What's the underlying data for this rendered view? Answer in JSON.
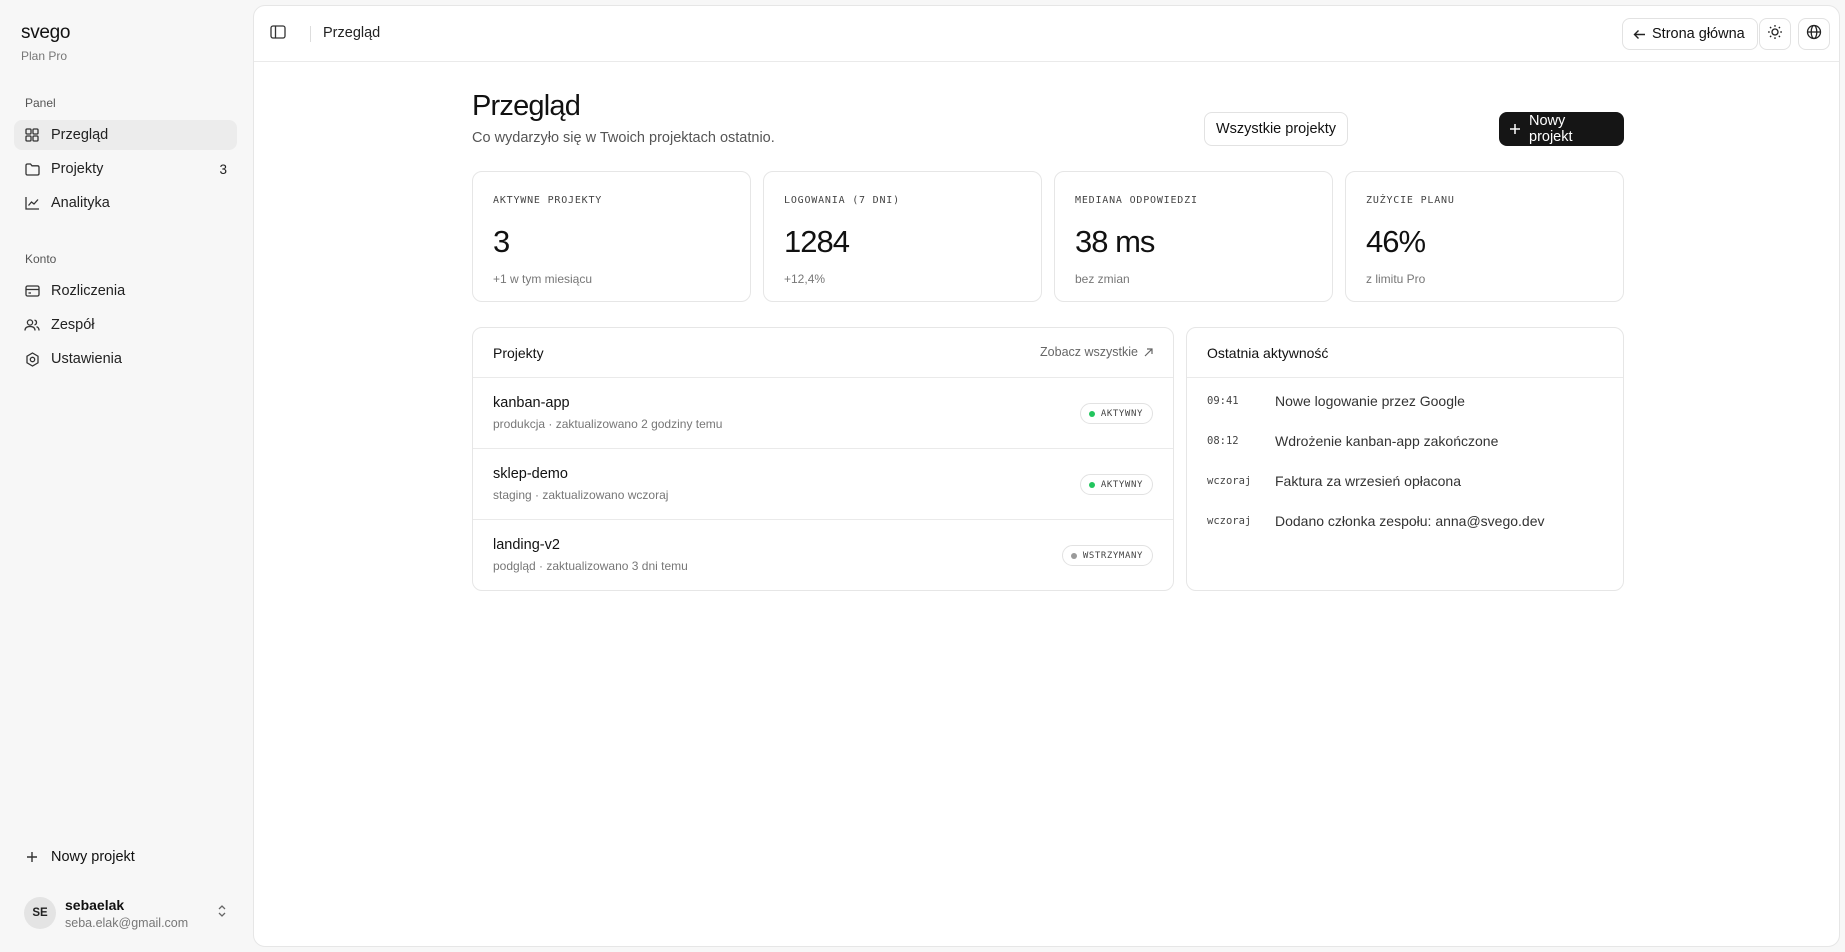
{
  "app": {
    "name": "svego",
    "plan": "Plan Pro"
  },
  "sidebar": {
    "panel_label": "Panel",
    "account_label": "Konto",
    "panel_items": [
      {
        "label": "Przegląd",
        "icon": "grid-icon",
        "active": true
      },
      {
        "label": "Projekty",
        "icon": "folder-icon",
        "count": "3"
      },
      {
        "label": "Analityka",
        "icon": "chart-line-icon"
      }
    ],
    "account_items": [
      {
        "label": "Rozliczenia",
        "icon": "credit-card-icon"
      },
      {
        "label": "Zespół",
        "icon": "users-icon"
      },
      {
        "label": "Ustawienia",
        "icon": "settings-icon"
      }
    ],
    "new_project_label": "Nowy projekt",
    "user": {
      "initials": "SE",
      "name": "sebaelak",
      "email": "seba.elak@gmail.com"
    }
  },
  "topbar": {
    "title": "Przegląd",
    "home_label": "Strona główna",
    "theme_icon": "sun-icon",
    "language_icon": "globe-icon"
  },
  "page": {
    "title": "Przegląd",
    "subtitle": "Co wydarzyło się w Twoich projektach ostatnio.",
    "all_projects_label": "Wszystkie projekty",
    "new_project_label": "Nowy projekt"
  },
  "stats": [
    {
      "label": "AKTYWNE PROJEKTY",
      "value": "3",
      "note": "+1 w tym miesiącu"
    },
    {
      "label": "LOGOWANIA (7 DNI)",
      "value": "1284",
      "note": "+12,4%"
    },
    {
      "label": "MEDIANA ODPOWIEDZI",
      "value": "38 ms",
      "note": "bez zmian"
    },
    {
      "label": "ZUŻYCIE PLANU",
      "value": "46%",
      "note": "z limitu Pro"
    }
  ],
  "projects": {
    "title": "Projekty",
    "see_all_label": "Zobacz wszystkie",
    "items": [
      {
        "name": "kanban-app",
        "meta": "produkcja · zaktualizowano 2 godziny temu",
        "status": "AKTYWNY",
        "status_color": "#22c55e"
      },
      {
        "name": "sklep-demo",
        "meta": "staging · zaktualizowano wczoraj",
        "status": "AKTYWNY",
        "status_color": "#22c55e"
      },
      {
        "name": "landing-v2",
        "meta": "podgląd · zaktualizowano 3 dni temu",
        "status": "WSTRZYMANY",
        "status_color": "#9a9a9a"
      }
    ]
  },
  "activity": {
    "title": "Ostatnia aktywność",
    "items": [
      {
        "time": "09:41",
        "text": "Nowe logowanie przez Google"
      },
      {
        "time": "08:12",
        "text": "Wdrożenie kanban-app zakończone"
      },
      {
        "time": "wczoraj",
        "text": "Faktura za wrzesień opłacona"
      },
      {
        "time": "wczoraj",
        "text": "Dodano członka zespołu: anna@svego.dev"
      }
    ]
  }
}
